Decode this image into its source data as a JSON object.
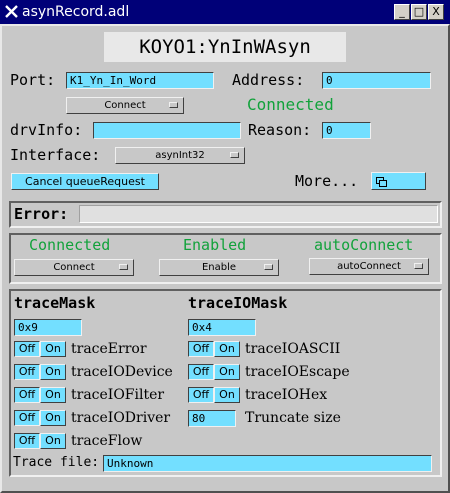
{
  "window": {
    "title": "asynRecord.adl",
    "minimize_glyph": "_",
    "maximize_glyph": "□",
    "close_glyph": "X"
  },
  "record_name": "KOYO1:YnInWAsyn",
  "port": {
    "label": "Port:",
    "value": "K1_Yn_In_Word"
  },
  "address": {
    "label": "Address:",
    "value": "0"
  },
  "connect_menu": {
    "selected": "Connect"
  },
  "connection_status": "Connected",
  "drvinfo": {
    "label": "drvInfo:",
    "value": ""
  },
  "reason": {
    "label": "Reason:",
    "value": "0"
  },
  "interface": {
    "label": "Interface:",
    "selected": "asynInt32"
  },
  "cancel_button": "Cancel queueRequest",
  "more_label": "More...",
  "error": {
    "label": "Error:",
    "value": ""
  },
  "status": {
    "connected": "Connected",
    "enabled": "Enabled",
    "autoconnect": "autoConnect",
    "connect_menu": "Connect",
    "enable_menu": "Enable",
    "autoconnect_menu": "autoConnect"
  },
  "trace": {
    "mask_label": "traceMask",
    "mask_value": "0x9",
    "io_mask_label": "traceIOMask",
    "io_mask_value": "0x4",
    "off": "Off",
    "on": "On",
    "trace_error": "traceError",
    "trace_io_device": "traceIODevice",
    "trace_io_filter": "traceIOFilter",
    "trace_io_driver": "traceIODriver",
    "trace_flow": "traceFlow",
    "trace_io_ascii": "traceIOASCII",
    "trace_io_escape": "traceIOEscape",
    "trace_io_hex": "traceIOHex",
    "truncate_label": "Truncate size",
    "truncate_value": "80",
    "file_label": "Trace file:",
    "file_value": "Unknown"
  },
  "colors": {
    "background": "#c8c8c8",
    "field": "#73dfff",
    "status_green": "#12a23b",
    "title_bar": "#000078"
  }
}
